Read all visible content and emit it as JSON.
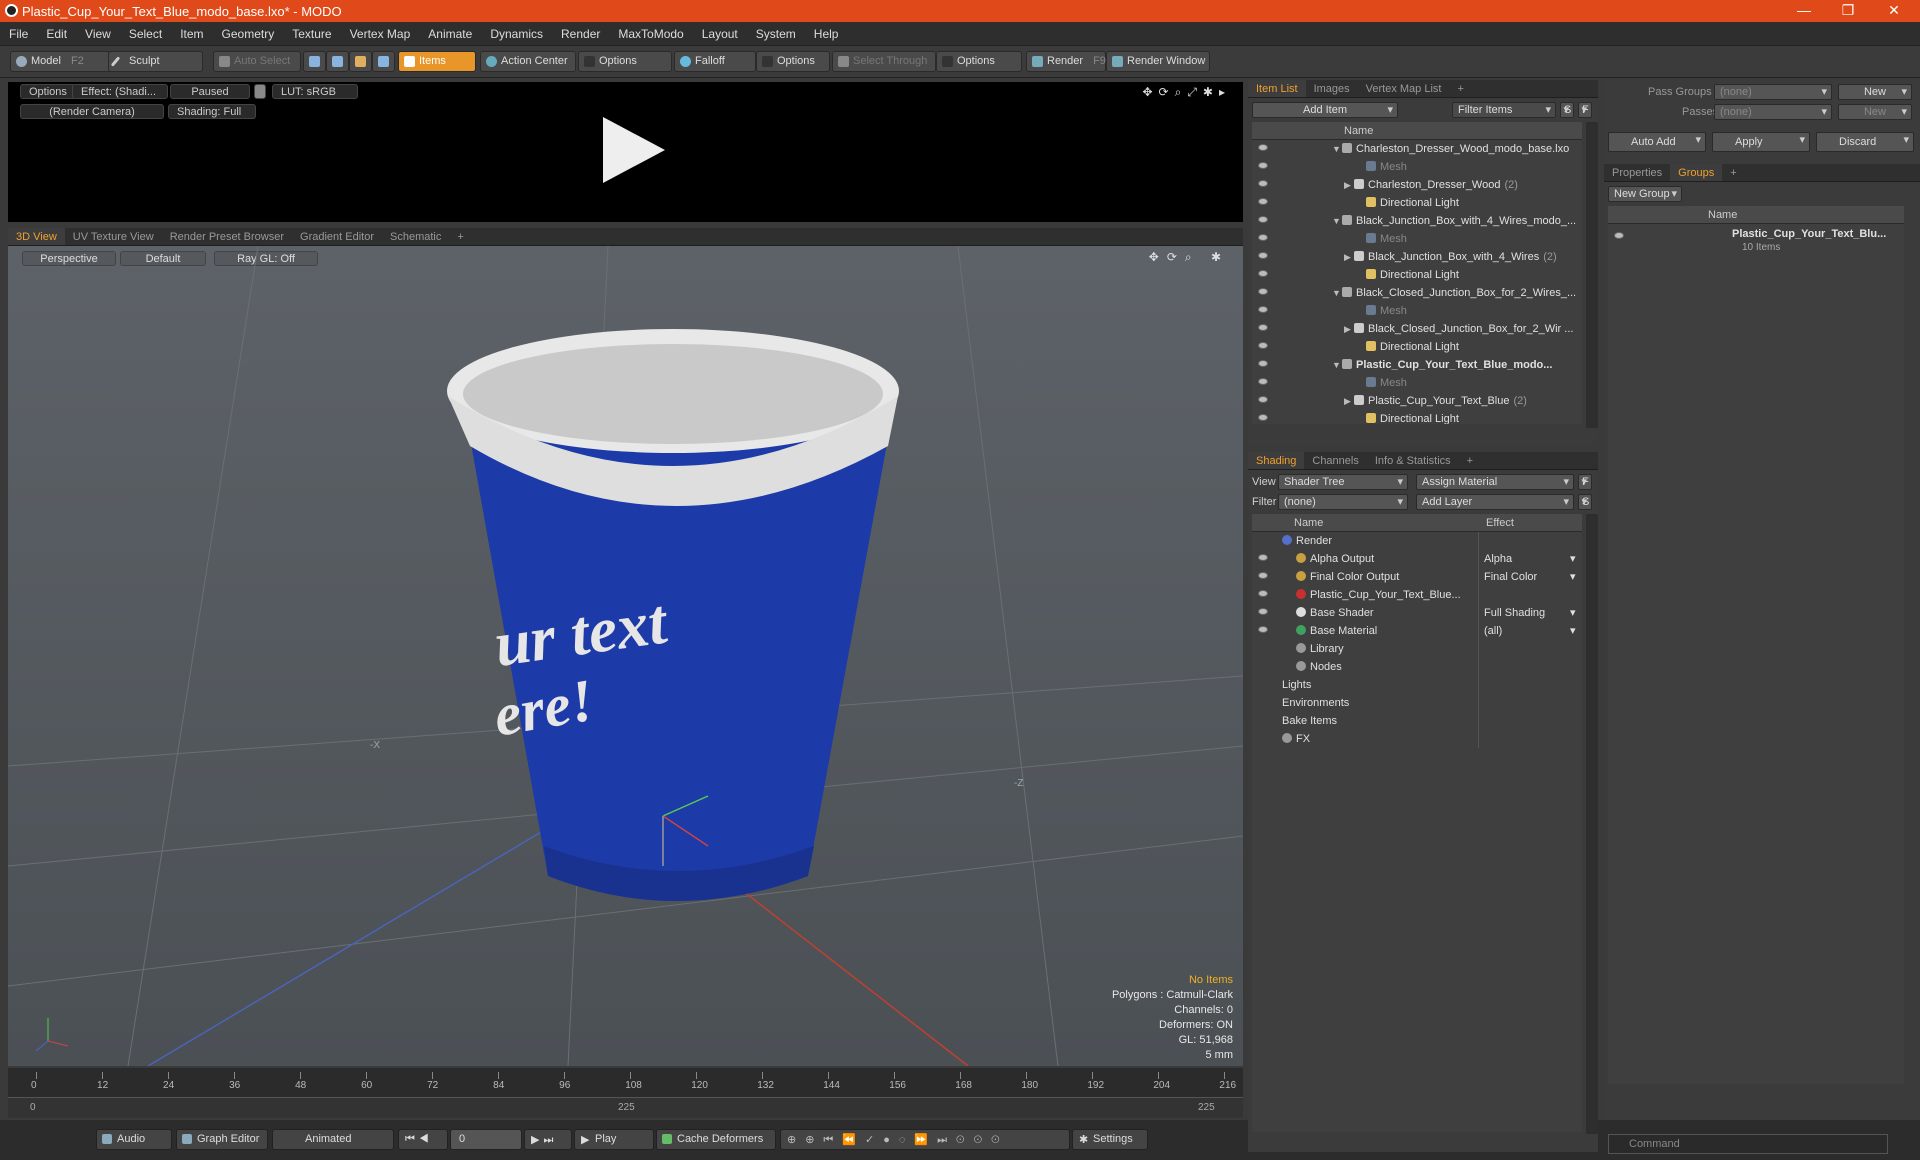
{
  "app": {
    "title": "Plastic_Cup_Your_Text_Blue_modo_base.lxo* - MODO"
  },
  "window_controls": {
    "minimize": "—",
    "restore": "❐",
    "close": "✕"
  },
  "menu": [
    "File",
    "Edit",
    "View",
    "Select",
    "Item",
    "Geometry",
    "Texture",
    "Vertex Map",
    "Animate",
    "Dynamics",
    "Render",
    "MaxToModo",
    "Layout",
    "System",
    "Help"
  ],
  "toolbar": {
    "model": "Model",
    "model_key": "F2",
    "sculpt": "Sculpt",
    "auto_select": "Auto Select",
    "items": "Items",
    "action_center": "Action Center",
    "options1": "Options",
    "falloff": "Falloff",
    "options2": "Options",
    "select_through": "Select Through",
    "options3": "Options",
    "render": "Render",
    "render_key": "F9",
    "render_window": "Render Window"
  },
  "preview": {
    "options": "Options",
    "effect": "Effect: (Shadi...",
    "paused": "Paused",
    "lut": "LUT: sRGB",
    "camera": "(Render Camera)",
    "shading": "Shading: Full"
  },
  "view_tabs": [
    "3D View",
    "UV Texture View",
    "Render Preset Browser",
    "Gradient Editor",
    "Schematic",
    "+"
  ],
  "viewport": {
    "perspective": "Perspective",
    "default": "Default",
    "raygl": "Ray GL: Off",
    "cup_text": "ur text\nere!",
    "axis_x": "-X",
    "axis_z": "-Z"
  },
  "stats": {
    "no_items": "No Items",
    "polygons": "Polygons : Catmull-Clark",
    "channels": "Channels: 0",
    "deformers": "Deformers: ON",
    "gl": "GL: 51,968",
    "scale": "5 mm"
  },
  "timeline": {
    "ticks": [
      "0",
      "12",
      "24",
      "36",
      "48",
      "60",
      "72",
      "84",
      "96",
      "108",
      "120",
      "132",
      "144",
      "156",
      "168",
      "180",
      "192",
      "204",
      "216"
    ],
    "range_start": "0",
    "range_mid": "225",
    "range_end": "225"
  },
  "bottom": {
    "audio": "Audio",
    "graph_editor": "Graph Editor",
    "animated": "Animated",
    "frame": "0",
    "play": "Play",
    "cache_deformers": "Cache Deformers",
    "settings": "Settings"
  },
  "item_list": {
    "tabs": [
      "Item List",
      "Images",
      "Vertex Map List",
      "+"
    ],
    "add_item": "Add Item",
    "filter_items": "Filter Items",
    "s": "S",
    "f": "F",
    "name_col": "Name",
    "rows": [
      {
        "label": "Charleston_Dresser_Wood_modo_base.lxo",
        "indent": 0,
        "type": "scene",
        "dim": false,
        "bold": false,
        "count": ""
      },
      {
        "label": "Mesh",
        "indent": 2,
        "type": "mesh",
        "dim": true,
        "bold": false,
        "count": ""
      },
      {
        "label": "Charleston_Dresser_Wood",
        "indent": 1,
        "type": "group",
        "dim": false,
        "bold": false,
        "count": "(2)"
      },
      {
        "label": "Directional Light",
        "indent": 2,
        "type": "light",
        "dim": false,
        "bold": false,
        "count": ""
      },
      {
        "label": "Black_Junction_Box_with_4_Wires_modo_...",
        "indent": 0,
        "type": "scene",
        "dim": false,
        "bold": false,
        "count": ""
      },
      {
        "label": "Mesh",
        "indent": 2,
        "type": "mesh",
        "dim": true,
        "bold": false,
        "count": ""
      },
      {
        "label": "Black_Junction_Box_with_4_Wires",
        "indent": 1,
        "type": "group",
        "dim": false,
        "bold": false,
        "count": "(2)"
      },
      {
        "label": "Directional Light",
        "indent": 2,
        "type": "light",
        "dim": false,
        "bold": false,
        "count": ""
      },
      {
        "label": "Black_Closed_Junction_Box_for_2_Wires_...",
        "indent": 0,
        "type": "scene",
        "dim": false,
        "bold": false,
        "count": ""
      },
      {
        "label": "Mesh",
        "indent": 2,
        "type": "mesh",
        "dim": true,
        "bold": false,
        "count": ""
      },
      {
        "label": "Black_Closed_Junction_Box_for_2_Wir ...",
        "indent": 1,
        "type": "group",
        "dim": false,
        "bold": false,
        "count": ""
      },
      {
        "label": "Directional Light",
        "indent": 2,
        "type": "light",
        "dim": false,
        "bold": false,
        "count": ""
      },
      {
        "label": "Plastic_Cup_Your_Text_Blue_modo...",
        "indent": 0,
        "type": "scene",
        "dim": false,
        "bold": true,
        "count": ""
      },
      {
        "label": "Mesh",
        "indent": 2,
        "type": "mesh",
        "dim": true,
        "bold": false,
        "count": ""
      },
      {
        "label": "Plastic_Cup_Your_Text_Blue",
        "indent": 1,
        "type": "group",
        "dim": false,
        "bold": false,
        "count": "(2)"
      },
      {
        "label": "Directional Light",
        "indent": 2,
        "type": "light",
        "dim": false,
        "bold": false,
        "count": ""
      }
    ]
  },
  "shading": {
    "tabs": [
      "Shading",
      "Channels",
      "Info & Statistics",
      "+"
    ],
    "view_label": "View",
    "view_value": "Shader Tree",
    "assign_material": "Assign Material",
    "f": "F",
    "filter_label": "Filter",
    "filter_value": "(none)",
    "add_layer": "Add Layer",
    "s": "S",
    "name_col": "Name",
    "effect_col": "Effect",
    "rows": [
      {
        "label": "Render",
        "effect": "",
        "indent": 0,
        "icon": "#5570c8",
        "eye": false
      },
      {
        "label": "Alpha Output",
        "effect": "Alpha",
        "indent": 1,
        "icon": "#c8a040",
        "eye": true
      },
      {
        "label": "Final Color Output",
        "effect": "Final Color",
        "indent": 1,
        "icon": "#c8a040",
        "eye": true
      },
      {
        "label": "Plastic_Cup_Your_Text_Blue...",
        "effect": "",
        "indent": 1,
        "icon": "#c83030",
        "eye": true
      },
      {
        "label": "Base Shader",
        "effect": "Full Shading",
        "indent": 1,
        "icon": "#dddddd",
        "eye": true
      },
      {
        "label": "Base Material",
        "effect": "(all)",
        "indent": 1,
        "icon": "#40a060",
        "eye": true
      },
      {
        "label": "Library",
        "effect": "",
        "indent": 1,
        "icon": "#999999",
        "eye": false
      },
      {
        "label": "Nodes",
        "effect": "",
        "indent": 1,
        "icon": "#999999",
        "eye": false
      },
      {
        "label": "Lights",
        "effect": "",
        "indent": 0,
        "icon": "",
        "eye": false
      },
      {
        "label": "Environments",
        "effect": "",
        "indent": 0,
        "icon": "",
        "eye": false
      },
      {
        "label": "Bake Items",
        "effect": "",
        "indent": 0,
        "icon": "",
        "eye": false
      },
      {
        "label": "FX",
        "effect": "",
        "indent": 0,
        "icon": "#999999",
        "eye": false
      }
    ]
  },
  "right": {
    "pass_groups": "Pass Groups",
    "pass_groups_value": "(none)",
    "new1": "New",
    "passes": "Passes",
    "passes_value": "(none)",
    "new2": "New",
    "auto_add": "Auto Add",
    "apply": "Apply",
    "discard": "Discard",
    "tabs": [
      "Properties",
      "Groups",
      "+"
    ],
    "new_group": "New Group",
    "name_col": "Name",
    "group_name": "Plastic_Cup_Your_Text_Blu...",
    "group_count": "10 Items"
  },
  "command": {
    "placeholder": "Command"
  }
}
